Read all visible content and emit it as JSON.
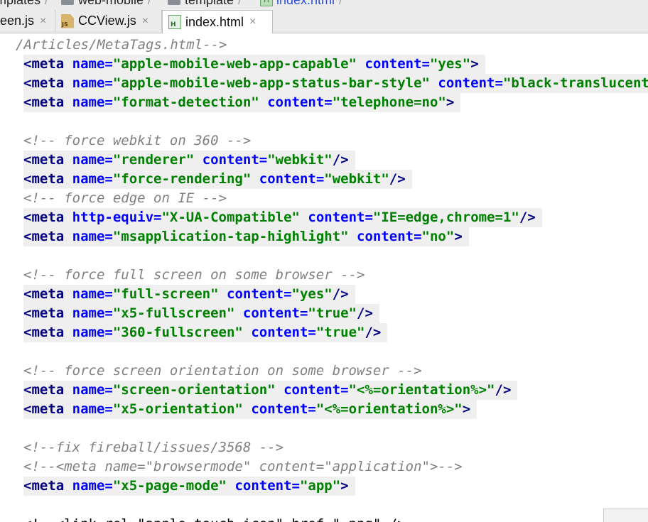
{
  "breadcrumbs": [
    "mplates",
    "web-mobile",
    "template",
    "index.html"
  ],
  "tabs": [
    {
      "label": "een.js",
      "icon": "js-file-icon",
      "active": false
    },
    {
      "label": "CCView.js",
      "icon": "js-file-icon",
      "active": false
    },
    {
      "label": "index.html",
      "icon": "html-file-icon",
      "active": true
    }
  ],
  "close_glyph": "×",
  "icon_labels": {
    "js": "JS",
    "html": "H"
  },
  "code": {
    "path_comment": "/Articles/MetaTags.html-->",
    "lines": [
      {
        "hl": true,
        "tokens": [
          [
            "tg",
            "<meta "
          ],
          [
            "an",
            "name="
          ],
          [
            "av",
            "\"apple-mobile-web-app-capable\""
          ],
          [
            "pn",
            " "
          ],
          [
            "an",
            "content="
          ],
          [
            "av",
            "\"yes\""
          ],
          [
            "tg",
            ">"
          ]
        ]
      },
      {
        "hl": true,
        "tokens": [
          [
            "tg",
            "<meta "
          ],
          [
            "an",
            "name="
          ],
          [
            "av",
            "\"apple-mobile-web-app-status-bar-style\""
          ],
          [
            "pn",
            " "
          ],
          [
            "an",
            "content="
          ],
          [
            "av",
            "\"black-translucent\""
          ]
        ]
      },
      {
        "hl": true,
        "tokens": [
          [
            "tg",
            "<meta "
          ],
          [
            "an",
            "name="
          ],
          [
            "av",
            "\"format-detection\""
          ],
          [
            "pn",
            " "
          ],
          [
            "an",
            "content="
          ],
          [
            "av",
            "\"telephone=no\""
          ],
          [
            "tg",
            ">"
          ]
        ]
      },
      {
        "hl": false,
        "tokens": []
      },
      {
        "hl": false,
        "tokens": [
          [
            "cm",
            "<!-- force webkit on 360 -->"
          ]
        ]
      },
      {
        "hl": true,
        "tokens": [
          [
            "tg",
            "<meta "
          ],
          [
            "an",
            "name="
          ],
          [
            "av",
            "\"renderer\""
          ],
          [
            "pn",
            " "
          ],
          [
            "an",
            "content="
          ],
          [
            "av",
            "\"webkit\""
          ],
          [
            "tg",
            "/>"
          ]
        ]
      },
      {
        "hl": true,
        "tokens": [
          [
            "tg",
            "<meta "
          ],
          [
            "an",
            "name="
          ],
          [
            "av",
            "\"force-rendering\""
          ],
          [
            "pn",
            " "
          ],
          [
            "an",
            "content="
          ],
          [
            "av",
            "\"webkit\""
          ],
          [
            "tg",
            "/>"
          ]
        ]
      },
      {
        "hl": false,
        "tokens": [
          [
            "cm",
            "<!-- force edge on IE -->"
          ]
        ]
      },
      {
        "hl": true,
        "tokens": [
          [
            "tg",
            "<meta "
          ],
          [
            "an",
            "http-equiv="
          ],
          [
            "av",
            "\"X-UA-Compatible\""
          ],
          [
            "pn",
            " "
          ],
          [
            "an",
            "content="
          ],
          [
            "av",
            "\"IE=edge,chrome=1\""
          ],
          [
            "tg",
            "/>"
          ]
        ]
      },
      {
        "hl": true,
        "tokens": [
          [
            "tg",
            "<meta "
          ],
          [
            "an",
            "name="
          ],
          [
            "av",
            "\"msapplication-tap-highlight\""
          ],
          [
            "pn",
            " "
          ],
          [
            "an",
            "content="
          ],
          [
            "av",
            "\"no\""
          ],
          [
            "tg",
            ">"
          ]
        ]
      },
      {
        "hl": false,
        "tokens": []
      },
      {
        "hl": false,
        "tokens": [
          [
            "cm",
            "<!-- force full screen on some browser -->"
          ]
        ]
      },
      {
        "hl": true,
        "tokens": [
          [
            "tg",
            "<meta "
          ],
          [
            "an",
            "name="
          ],
          [
            "av",
            "\"full-screen\""
          ],
          [
            "pn",
            " "
          ],
          [
            "an",
            "content="
          ],
          [
            "av",
            "\"yes\""
          ],
          [
            "tg",
            "/>"
          ]
        ]
      },
      {
        "hl": true,
        "tokens": [
          [
            "tg",
            "<meta "
          ],
          [
            "an",
            "name="
          ],
          [
            "av",
            "\"x5-fullscreen\""
          ],
          [
            "pn",
            " "
          ],
          [
            "an",
            "content="
          ],
          [
            "av",
            "\"true\""
          ],
          [
            "tg",
            "/>"
          ]
        ]
      },
      {
        "hl": true,
        "tokens": [
          [
            "tg",
            "<meta "
          ],
          [
            "an",
            "name="
          ],
          [
            "av",
            "\"360-fullscreen\""
          ],
          [
            "pn",
            " "
          ],
          [
            "an",
            "content="
          ],
          [
            "av",
            "\"true\""
          ],
          [
            "tg",
            "/>"
          ]
        ]
      },
      {
        "hl": false,
        "tokens": []
      },
      {
        "hl": false,
        "tokens": [
          [
            "cm",
            "<!-- force screen orientation on some browser -->"
          ]
        ]
      },
      {
        "hl": true,
        "tokens": [
          [
            "tg",
            "<meta "
          ],
          [
            "an",
            "name="
          ],
          [
            "av",
            "\"screen-orientation\""
          ],
          [
            "pn",
            " "
          ],
          [
            "an",
            "content="
          ],
          [
            "av",
            "\"<%=orientation%>\""
          ],
          [
            "tg",
            "/>"
          ]
        ]
      },
      {
        "hl": true,
        "tokens": [
          [
            "tg",
            "<meta "
          ],
          [
            "an",
            "name="
          ],
          [
            "av",
            "\"x5-orientation\""
          ],
          [
            "pn",
            " "
          ],
          [
            "an",
            "content="
          ],
          [
            "av",
            "\"<%=orientation%>\""
          ],
          [
            "tg",
            ">"
          ]
        ]
      },
      {
        "hl": false,
        "tokens": []
      },
      {
        "hl": false,
        "tokens": [
          [
            "cm",
            "<!--fix fireball/issues/3568 -->"
          ]
        ]
      },
      {
        "hl": false,
        "tokens": [
          [
            "cm",
            "<!--<meta name=\"browsermode\" content=\"application\">-->"
          ]
        ]
      },
      {
        "hl": true,
        "tokens": [
          [
            "tg",
            "<meta "
          ],
          [
            "an",
            "name="
          ],
          [
            "av",
            "\"x5-page-mode\""
          ],
          [
            "pn",
            " "
          ],
          [
            "an",
            "content="
          ],
          [
            "av",
            "\"app\""
          ],
          [
            "tg",
            ">"
          ]
        ]
      },
      {
        "hl": false,
        "tokens": []
      },
      {
        "hl": false,
        "tokens": [
          [
            "pn",
            "<!--<link rel=\"apple-touch-icon\" href=\".png\" />"
          ]
        ]
      }
    ]
  }
}
